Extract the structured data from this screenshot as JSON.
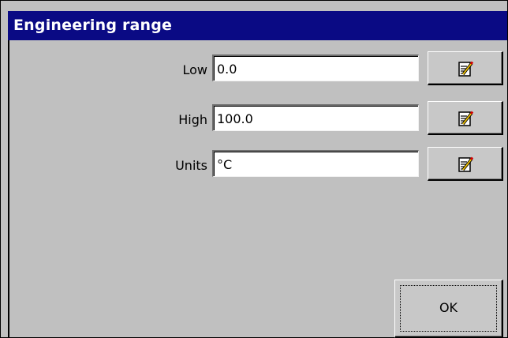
{
  "dialog": {
    "title": "Engineering range"
  },
  "fields": [
    {
      "label": "Low",
      "value": "0.0"
    },
    {
      "label": "High",
      "value": "100.0"
    },
    {
      "label": "Units",
      "value": "°C"
    }
  ],
  "edit_button_icon": "edit-notepad-icon",
  "ok_button": {
    "label": "OK"
  }
}
